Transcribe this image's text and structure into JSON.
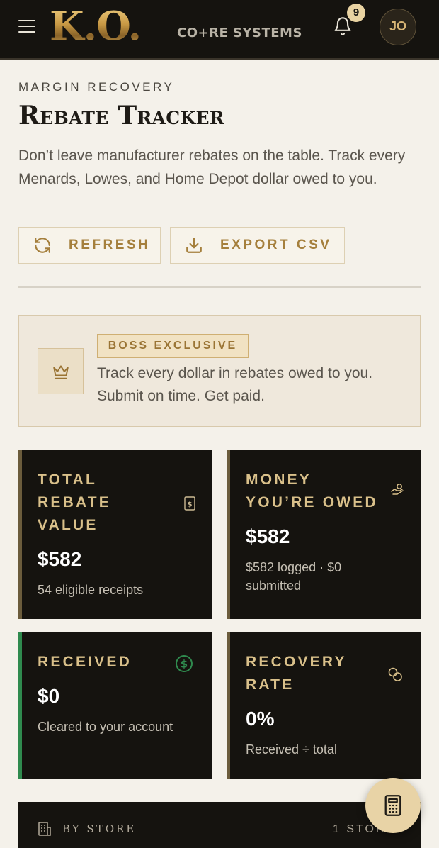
{
  "header": {
    "logo_main": "K.O.",
    "logo_sub": "CO+RE SYSTEMS",
    "notification_count": "9",
    "avatar_initials": "JO"
  },
  "intro": {
    "eyebrow": "MARGIN RECOVERY",
    "title": "Rebate Tracker",
    "subtitle": "Don’t leave manufacturer rebates on the table. Track every Menards, Lowes, and Home Depot dollar owed to you."
  },
  "actions": {
    "refresh_label": "REFRESH",
    "export_label": "EXPORT CSV"
  },
  "banner": {
    "badge": "BOSS EXCLUSIVE",
    "text": "Track every dollar in rebates owed to you. Submit on time. Get paid."
  },
  "stats": {
    "total": {
      "label_lines": [
        "TOTAL",
        "REBATE",
        "VALUE"
      ],
      "value": "$582",
      "note": "54 eligible receipts",
      "icon": "receipt-dollar-icon"
    },
    "owed": {
      "label_lines": [
        "MONEY",
        "YOU’RE OWED"
      ],
      "value": "$582",
      "note_lines": [
        "$582 logged · $0",
        "submitted"
      ],
      "icon": "hand-coins-icon"
    },
    "received": {
      "label_lines": [
        "RECEIVED"
      ],
      "value": "$0",
      "note": "Cleared to your account",
      "icon": "dollar-circle-icon",
      "accent": "#2f8a4e"
    },
    "rate": {
      "label_lines": [
        "RECOVERY",
        "RATE"
      ],
      "value": "0%",
      "note": "Received ÷ total",
      "icon": "coins-icon"
    }
  },
  "store_panel": {
    "label": "BY STORE",
    "count": "1 STORE"
  },
  "colors": {
    "header_bg": "#15130f",
    "page_bg": "#f4f1ea",
    "gold": "#a57f3c",
    "card_bg": "#15130f",
    "green": "#2f8a4e"
  }
}
